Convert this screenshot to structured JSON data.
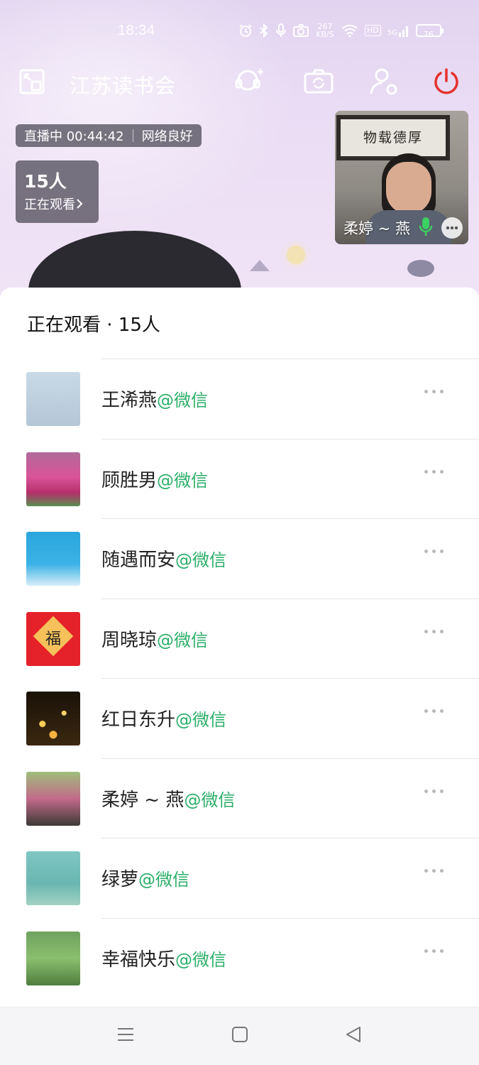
{
  "status_bar": {
    "time": "18:34",
    "net_speed": "267 KB/S",
    "signal_label": "5G",
    "battery": "76",
    "icons": [
      "alarm-icon",
      "bluetooth-icon",
      "mic-icon",
      "camera-icon",
      "wifi-icon",
      "hd-icon",
      "signal-icon",
      "battery-icon"
    ]
  },
  "toolbar": {
    "title": "江苏读书会",
    "icons": [
      "exit-pip-icon",
      "add-guest-icon",
      "switch-camera-icon",
      "member-settings-icon",
      "power-icon"
    ],
    "power_color": "#e5322d"
  },
  "live": {
    "status": "直播中 00:44:42",
    "network": "网络良好",
    "viewer_count": "15人",
    "viewer_sub": "正在观看"
  },
  "video_tile": {
    "plaque_text": "物载德厚",
    "name": "柔婷 ~ 燕"
  },
  "sheet": {
    "header": "正在观看 · 15人",
    "source_color": "#2aae67",
    "viewers": [
      {
        "name": "王浠燕",
        "source": "@微信"
      },
      {
        "name": "顾胜男",
        "source": "@微信"
      },
      {
        "name": "随遇而安",
        "source": "@微信"
      },
      {
        "name": "周晓琼",
        "source": "@微信"
      },
      {
        "name": "红日东升",
        "source": "@微信"
      },
      {
        "name": "柔婷 ~ 燕",
        "source": "@微信"
      },
      {
        "name": "绿萝",
        "source": "@微信"
      },
      {
        "name": "幸福快乐",
        "source": "@微信"
      }
    ]
  },
  "avatar_4_text": "福",
  "nav_bar": {
    "icons": [
      "menu-icon",
      "home-icon",
      "back-icon"
    ]
  }
}
